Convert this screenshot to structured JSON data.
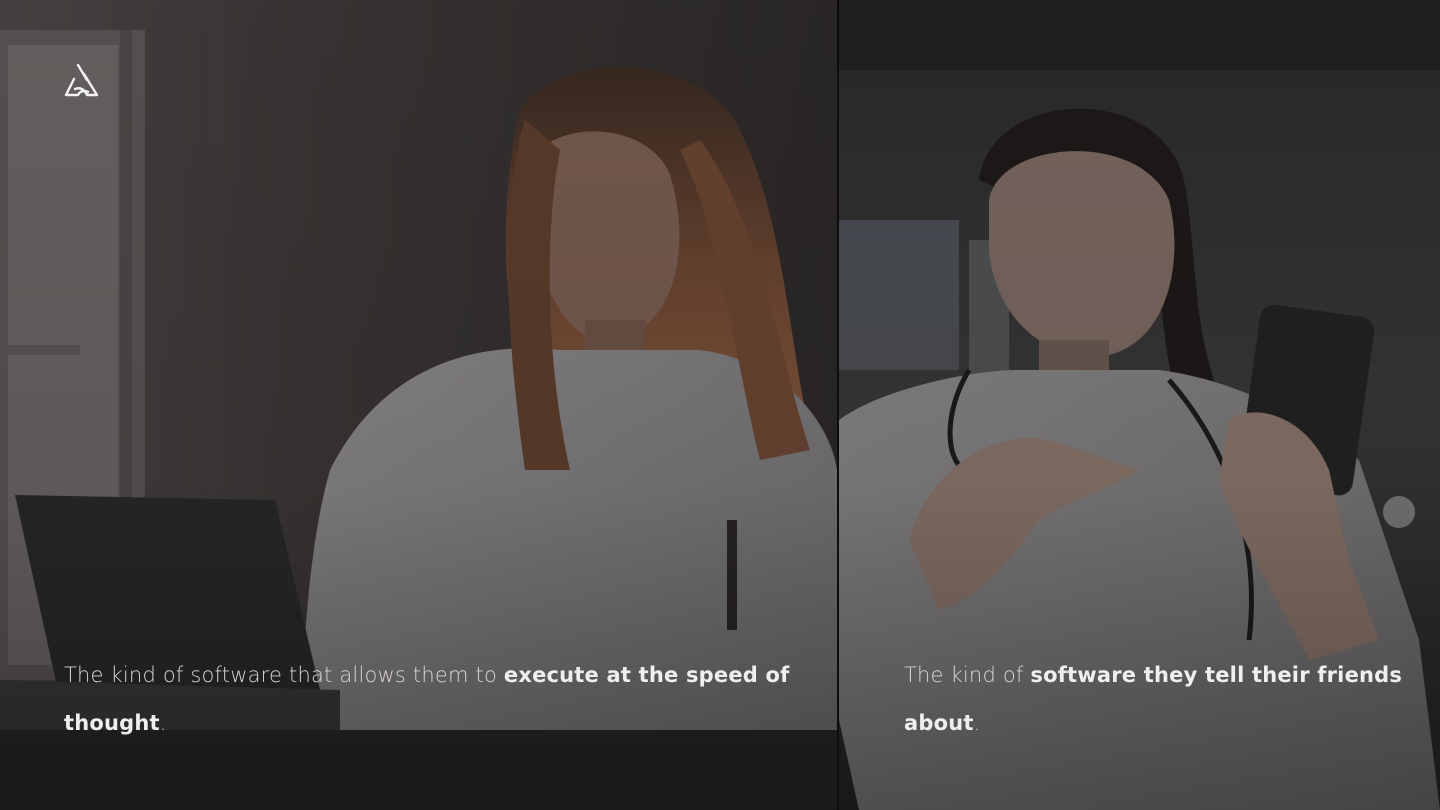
{
  "logo": {
    "icon": "triangle-knot-logo",
    "color": "#f2f2f2"
  },
  "panels": [
    {
      "caption": {
        "plain": "The kind of software that allows them to ",
        "bold": "execute at the speed of thought",
        "end": "."
      }
    },
    {
      "caption": {
        "plain": "The kind of ",
        "bold": "software they tell their friends about",
        "end": "."
      }
    }
  ],
  "colors": {
    "caption_text": "#d9d5d2",
    "caption_bold": "#f1efed",
    "divider": "#0d0d0d"
  }
}
